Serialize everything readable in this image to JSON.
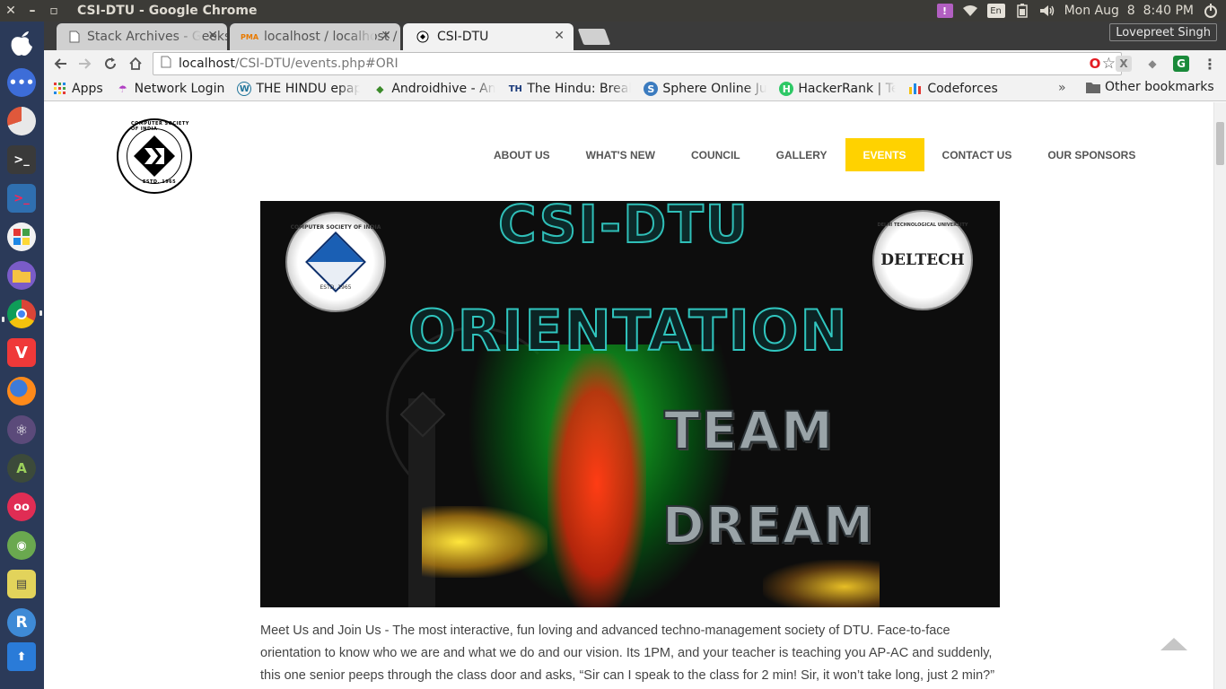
{
  "system": {
    "window_title": "CSI-DTU - Google Chrome",
    "clock": "Mon Aug  8  8:40 PM",
    "keyboard_layout": "En",
    "window_buttons": {
      "close": "✕",
      "minimize": "–",
      "maximize": "▫"
    }
  },
  "browser": {
    "tabs": [
      {
        "label": "Stack Archives - GeeksforGeeks",
        "favicon": "page-icon",
        "active": false
      },
      {
        "label": "localhost / localhost / phpMyAdmin",
        "favicon": "phpmyadmin-icon",
        "active": false
      },
      {
        "label": "CSI-DTU",
        "favicon": "csi-favicon",
        "active": true
      }
    ],
    "profile_name": "Lovepreet Singh",
    "url_host": "localhost",
    "url_path": "/CSI-DTU/events.php#ORI",
    "bookmarks": [
      {
        "label": "Apps",
        "icon": "apps-grid-icon"
      },
      {
        "label": "Network Login",
        "icon": "umbrella-icon"
      },
      {
        "label": "THE HINDU epaper",
        "icon": "wordpress-icon"
      },
      {
        "label": "Androidhive - Android",
        "icon": "androidhive-icon"
      },
      {
        "label": "The Hindu: Breaking News",
        "icon": "th-icon"
      },
      {
        "label": "Sphere Online Judge",
        "icon": "spoj-icon"
      },
      {
        "label": "HackerRank | Tech",
        "icon": "hackerrank-icon"
      },
      {
        "label": "Codeforces",
        "icon": "codeforces-icon"
      }
    ],
    "bookmarks_overflow": "»",
    "other_bookmarks": "Other bookmarks"
  },
  "site": {
    "logo_ring_text": "COMPUTER SOCIETY OF INDIA",
    "logo_estd": "ESTD. 1965",
    "nav": [
      {
        "label": "ABOUT US",
        "active": false
      },
      {
        "label": "WHAT'S NEW",
        "active": false
      },
      {
        "label": "COUNCIL",
        "active": false
      },
      {
        "label": "GALLERY",
        "active": false
      },
      {
        "label": "EVENTS",
        "active": true
      },
      {
        "label": "CONTACT US",
        "active": false
      },
      {
        "label": "OUR SPONSORS",
        "active": false
      }
    ],
    "banner": {
      "line1": "CSI-DTU",
      "line2": "ORIENTATION",
      "line3": "TEAM",
      "line4": "DREAM",
      "left_seal_text": "COMPUTER SOCIETY OF INDIA",
      "left_seal_estd": "ESTD. 1965",
      "right_seal_text": "DELTECH",
      "right_seal_ring": "DELHI TECHNOLOGICAL UNIVERSITY"
    },
    "description": "Meet Us and Join Us - The most interactive, fun loving and advanced techno-management society of DTU. Face-to-face orientation to know who we are and what we do and our vision. Its 1PM, and your teacher is teaching you AP-AC and suddenly, this one senior peeps through the class door and asks, “Sir can I speak to the class for 2 min! Sir, it won’t take long, just 2 min?”"
  },
  "colors": {
    "nav_active_bg": "#ffd200",
    "launcher_bg": "#2b3a59",
    "topbar_bg": "#3c3b37",
    "banner_text_outline": "#30c6bf"
  }
}
